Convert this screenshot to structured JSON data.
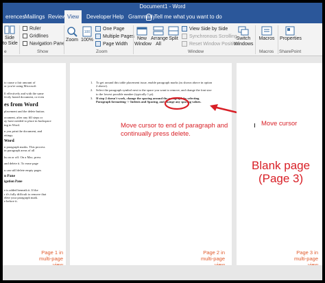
{
  "window": {
    "title": "Document1 - Word"
  },
  "tabs": [
    {
      "label": "erences"
    },
    {
      "label": "Mailings"
    },
    {
      "label": "Review"
    },
    {
      "label": "View"
    },
    {
      "label": "Developer"
    },
    {
      "label": "Help"
    },
    {
      "label": "Grammarly"
    }
  ],
  "tell_me": "Tell me what you want to do",
  "ribbon": {
    "side_to_side": [
      "Side",
      "to Side"
    ],
    "ruler": "Ruler",
    "gridlines": "Gridlines",
    "navigation_pane": "Navigation Pane",
    "show_group": "Show",
    "zoom": "Zoom",
    "zoom_100": "100%",
    "one_page": "One Page",
    "multiple_pages": "Multiple Pages",
    "page_width": "Page Width",
    "zoom_group": "Zoom",
    "new_window": [
      "New",
      "Window"
    ],
    "arrange_all": [
      "Arrange",
      "All"
    ],
    "split": "Split",
    "view_side_by_side": "View Side by Side",
    "sync_scrolling": "Synchronous Scrolling",
    "reset_window_position": "Reset Window Position",
    "switch_windows": [
      "Switch",
      "Windows"
    ],
    "window_group": "Window",
    "macros": "Macros",
    "macros_group": "Macros",
    "properties": "Properties",
    "sharepoint_group": "SharePoint",
    "left_group_label": "e"
  },
  "page1": {
    "lines": [
      "to cause a fair amount of",
      "or you're using Microsoft",
      "",
      "ll effectively and with the same",
      "fectly honed document, or even",
      "es from Word",
      "placement and the delete button.",
      "ocument, after any fill steps or",
      "ay have needed to place in backspace",
      "ing in Word.",
      "n you print the document, and",
      "ettings.",
      "Word",
      "n paragraph marks. This process",
      "in paragraph areas of all",
      "ks on or off. On a Mac, press",
      "and delete it. To erase page",
      "u can still delete empty pages",
      "n Pane",
      "igation Pane and selecting the",
      "e is added beneath it. If the",
      "r it's fully difficult to remove that",
      "elete your paragraph mark.",
      "e before it."
    ],
    "heading_from_word": "es from Word",
    "heading_word": "Word",
    "heading_pane": "n Pane",
    "heading_nav": "igation Pane",
    "caption": [
      "Page 1 in",
      "multi-page",
      "view"
    ]
  },
  "page2": {
    "list": [
      {
        "num": "1.",
        "text": "To get around this table placement issue, enable paragraph marks (as shown above in option 2 above)."
      },
      {
        "num": "2.",
        "text": "Select the paragraph symbol next to the space you want to remove, and change the font size to the lowest possible number (typically 1 pt)."
      },
      {
        "num": "3.",
        "text": "If step 2 doesn't work, change the spacing around the paragraph by selecting Paragraph formatting -> Indents and Spacing, and change any spacing values."
      }
    ],
    "annotation": [
      "Move cursor to end of paragraph and",
      "continually press delete."
    ],
    "caption": [
      "Page 2 in",
      "multi-page",
      "view"
    ]
  },
  "page3": {
    "move_cursor": "Move cursor",
    "blank_page": "Blank page",
    "page3_label": "(Page 3)",
    "caption": [
      "Page 3 in",
      "multi-page",
      "view"
    ]
  },
  "colors": {
    "word_blue": "#2b579a",
    "annotation_red": "#d81f26",
    "caption_orange": "#e05a2b"
  },
  "icons": [
    "side-to-side-icon",
    "zoom-icon",
    "100-percent-icon",
    "one-page-icon",
    "multiple-pages-icon",
    "page-width-icon",
    "new-window-icon",
    "arrange-all-icon",
    "split-icon",
    "view-side-by-side-icon",
    "sync-scrolling-icon",
    "reset-window-icon",
    "switch-windows-icon",
    "macros-icon",
    "properties-icon",
    "lightbulb-icon",
    "red-arrow-icon",
    "red-circle-highlight"
  ]
}
